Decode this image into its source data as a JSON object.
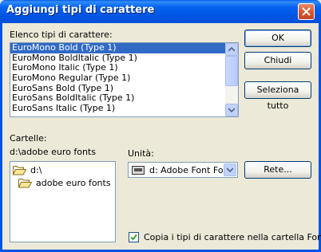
{
  "window": {
    "title": "Aggiungi tipi di carattere"
  },
  "font_list": {
    "label": "Elenco tipi di carattere:",
    "items": [
      "EuroMono Bold (Type 1)",
      "EuroMono BoldItalic (Type 1)",
      "EuroMono Italic (Type 1)",
      "EuroMono Regular (Type 1)",
      "EuroSans Bold (Type 1)",
      "EuroSans BoldItalic (Type 1)",
      "EuroSans Italic (Type 1)"
    ],
    "selected_index": 0
  },
  "buttons": {
    "ok": "OK",
    "close": "Chiudi",
    "select_all": "Seleziona tutto",
    "network": "Rete..."
  },
  "folders": {
    "label": "Cartelle:",
    "current_path": "d:\\adobe euro fonts",
    "items": [
      "d:\\",
      "adobe euro fonts"
    ]
  },
  "drive": {
    "label": "Unità:",
    "selected": "d: Adobe Font Folio"
  },
  "copy_option": {
    "label": "Copia i tipi di carattere nella cartella Fonts",
    "checked": true
  },
  "colors": {
    "title_bar": "#0054e3",
    "selection": "#316ac5",
    "dialog_bg": "#ece9d8"
  }
}
